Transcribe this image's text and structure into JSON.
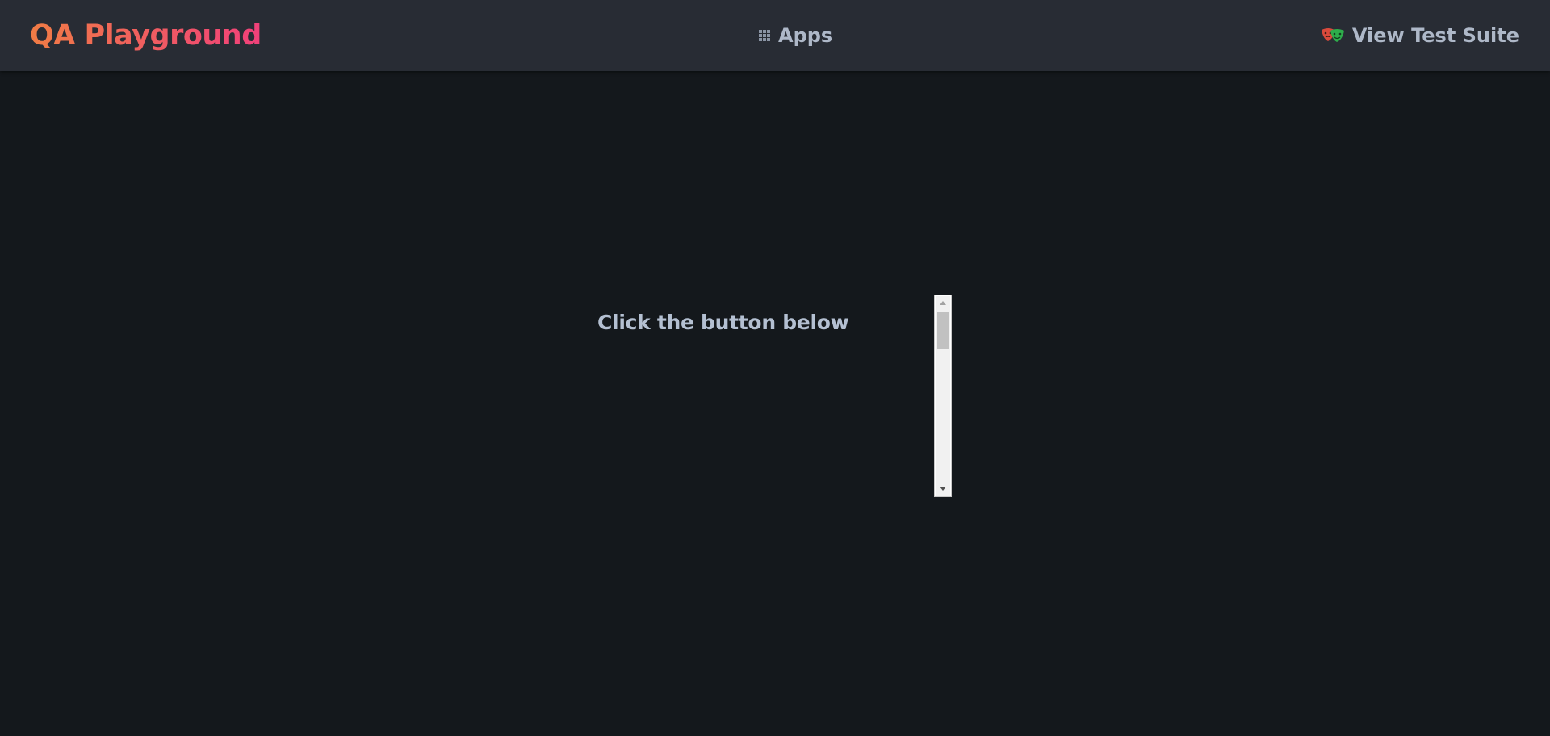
{
  "navbar": {
    "brand": "QA Playground",
    "apps_label": "Apps",
    "test_suite_label": "View Test Suite"
  },
  "main": {
    "heading": "Click the button below"
  }
}
